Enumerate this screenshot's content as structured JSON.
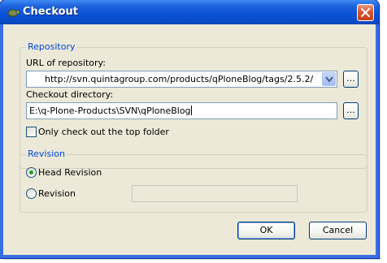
{
  "window": {
    "title": "Checkout",
    "icon": "tortoise-svn-icon",
    "close_icon": "close-icon"
  },
  "repository": {
    "legend": "Repository",
    "url_label": "URL of repository:",
    "url_value": "http://svn.quintagroup.com/products/qPloneBlog/tags/2.5.2/",
    "url_browse_label": "...",
    "dir_label": "Checkout directory:",
    "dir_value": "E:\\q-Plone-Products\\SVN\\qPloneBlog",
    "dir_browse_label": "...",
    "top_folder_label": "Only check out the top folder",
    "top_folder_checked": false
  },
  "revision": {
    "legend": "Revision",
    "head_label": "Head Revision",
    "head_selected": true,
    "revision_label": "Revision",
    "revision_selected": false,
    "revision_value": ""
  },
  "buttons": {
    "ok_label": "OK",
    "cancel_label": "Cancel"
  },
  "colors": {
    "titlebar": "#0851d6",
    "dialog_bg": "#ece9d8",
    "group_legend": "#0046d5",
    "close_button": "#d8562f"
  }
}
